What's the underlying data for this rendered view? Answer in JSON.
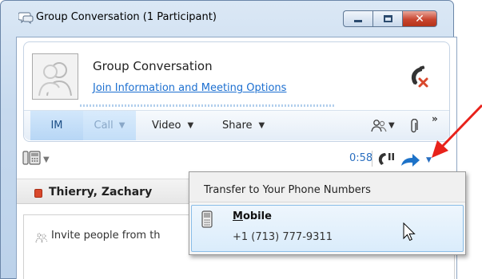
{
  "window": {
    "title": "Group Conversation (1 Participant)",
    "minimize_icon": "minimize-icon",
    "maximize_icon": "maximize-icon",
    "close_icon": "close-icon",
    "close_glyph": "✕"
  },
  "header": {
    "conversation_name": "Group Conversation",
    "join_link": "Join Information and Meeting Options",
    "hangup_icon": "hangup-icon"
  },
  "toolbar": {
    "tabs": [
      {
        "label": "IM",
        "state": "active"
      },
      {
        "label": "Call",
        "state": "disabled",
        "has_dropdown": true
      },
      {
        "label": "Video",
        "has_dropdown": true
      },
      {
        "label": "Share",
        "has_dropdown": true
      }
    ],
    "people_icon": "people-options-icon",
    "attach_icon": "paperclip-icon",
    "more_glyph": "»",
    "caret_glyph": "▼"
  },
  "call_controls": {
    "device_icon": "phone-device-icon",
    "timer": "0:58",
    "hold_icon": "hold-icon",
    "transfer_icon": "transfer-icon"
  },
  "participant": {
    "name": "Thierry, Zachary",
    "presence_color": "#d9482c"
  },
  "invite": {
    "text": "Invite people from th"
  },
  "transfer_menu": {
    "heading": "Transfer to Your Phone Numbers",
    "items": [
      {
        "label_underlined": "M",
        "label_rest": "obile",
        "number": "+1 (713) 777-9311",
        "icon": "mobile-phone-icon"
      }
    ]
  },
  "colors": {
    "accent": "#1c6fd0",
    "annotation": "#e8221b",
    "hangup": "#d9482c"
  }
}
